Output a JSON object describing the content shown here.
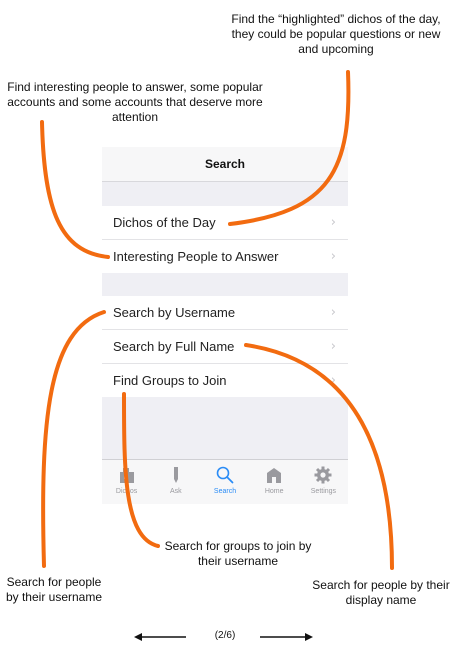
{
  "annotations": {
    "dichos": "Find the “highlighted” dichos of the day, they could be popular questions or new and upcoming",
    "interesting": "Find interesting people to answer, some popular accounts and some accounts that deserve more attention",
    "groups": "Search for groups to join by their username",
    "username": "Search for people by their username",
    "fullname": "Search for people by their display name"
  },
  "navbar": {
    "title": "Search"
  },
  "section1": [
    {
      "label": "Dichos of the Day"
    },
    {
      "label": "Interesting People to Answer"
    }
  ],
  "section2": [
    {
      "label": "Search by Username"
    },
    {
      "label": "Search by Full Name"
    },
    {
      "label": "Find Groups to Join"
    }
  ],
  "tabs": [
    {
      "label": "Dichos",
      "icon": "dichos-icon",
      "active": false
    },
    {
      "label": "Ask",
      "icon": "pen-icon",
      "active": false
    },
    {
      "label": "Search",
      "icon": "search-icon",
      "active": true
    },
    {
      "label": "Home",
      "icon": "home-icon",
      "active": false
    },
    {
      "label": "Settings",
      "icon": "gear-icon",
      "active": false
    }
  ],
  "pager": {
    "text": "(2/6)"
  },
  "colors": {
    "accent": "#2a8cf6",
    "callout": "#f26b10",
    "tab_inactive": "#9a9a9f"
  }
}
